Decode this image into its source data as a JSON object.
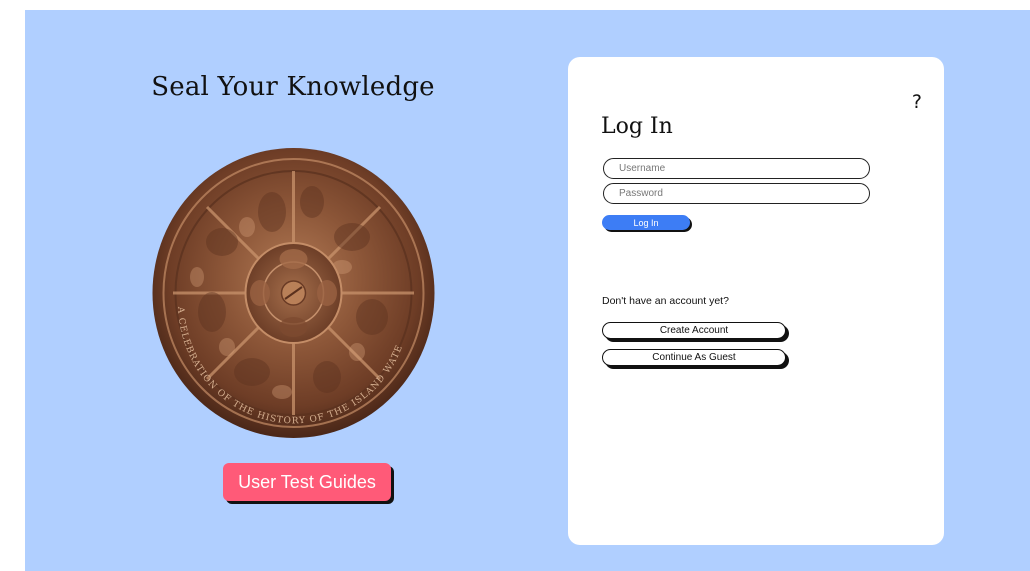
{
  "hero": {
    "title": "Seal Your Knowledge",
    "seal_image": "bronze-seal-image",
    "seal_inscription": "A CELEBRATION OF THE HISTORY OF THE ISLAND WATERS",
    "guides_button_label": "User Test Guides"
  },
  "login": {
    "help_label": "?",
    "title": "Log In",
    "username_placeholder": "Username",
    "password_placeholder": "Password",
    "login_button_label": "Log In",
    "no_account_text": "Don't have an account yet?",
    "create_account_label": "Create Account",
    "guest_label": "Continue As Guest"
  },
  "colors": {
    "background": "#b0cfff",
    "card": "#ffffff",
    "guides_button": "#ff5a78",
    "login_button": "#3d7df5",
    "shadow": "#111111"
  }
}
